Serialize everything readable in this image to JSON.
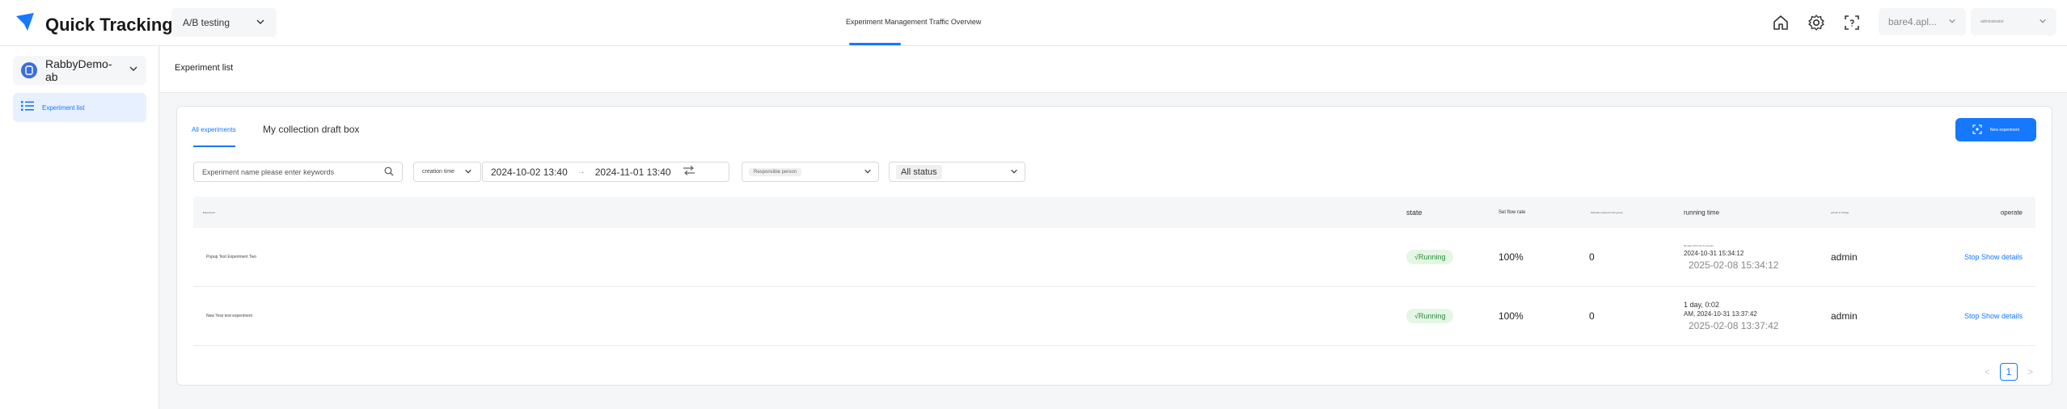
{
  "app": {
    "title": "Quick Tracking"
  },
  "header": {
    "product_select": "A/B testing",
    "center_tab": "Experiment Management Traffic Overview",
    "domain_select": "bare4.apl...",
    "user_select": "administrator"
  },
  "sidebar": {
    "app_name": "RabbyDemo-ab",
    "items": [
      {
        "label": "Experiment list"
      }
    ]
  },
  "page": {
    "title": "Experiment list"
  },
  "tabs": [
    {
      "label": "All experiments"
    },
    {
      "label": "My collection draft box"
    }
  ],
  "toolbar": {
    "new_button": "New experiment"
  },
  "filters": {
    "search_placeholder": "Experiment name please enter keywords",
    "time_type": "creation time",
    "date_start": "2024-10-02 13:40",
    "date_separator": "→",
    "date_end": "2024-11-01 13:40",
    "owner_placeholder": "Responsible person",
    "status": "All status"
  },
  "table": {
    "columns": {
      "name": "Experiment",
      "state": "state",
      "flow_rate": "Set flow rate",
      "samples": "Samples entered in the group",
      "running_time": "running time",
      "owner": "person in charge",
      "operate": "operate"
    },
    "rows": [
      {
        "name": "Popup Text Experiment Two",
        "state": "√Running",
        "flow_rate": "100%",
        "samples": "0",
        "time_line1": "99 days 23 hours 6 minutes",
        "time_line2": "2024-10-31 15:34:12",
        "time_line3": "2025-02-08 15:34:12",
        "owner": "admin",
        "operate": "Stop Show details"
      },
      {
        "name": "New Year test experiment",
        "state": "√Running",
        "flow_rate": "100%",
        "samples": "0",
        "time_line1": "1 day, 0:02",
        "time_line2": "AM, 2024-10-31 13:37:42",
        "time_line3": "2025-02-08 13:37:42",
        "owner": "admin",
        "operate": "Stop Show details"
      }
    ]
  },
  "pagination": {
    "prev": "<",
    "page": "1",
    "next": ">"
  },
  "colors": {
    "accent": "#1677ff",
    "running_bg": "#e4f6e4",
    "running_text": "#2b8a3e"
  }
}
